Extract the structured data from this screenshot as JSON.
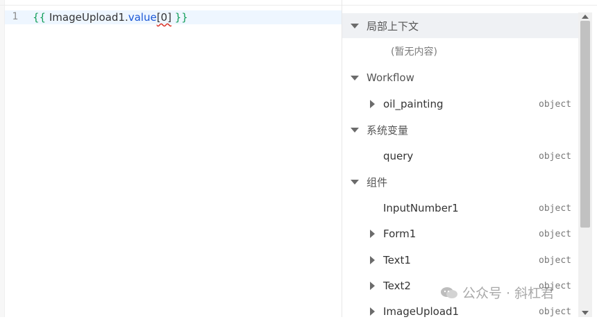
{
  "editor": {
    "line_number": "1",
    "code": {
      "open": "{{",
      "ident": " ImageUpload1.",
      "prop": "value",
      "index": "[0]",
      "close": " }}"
    }
  },
  "tree": {
    "sections": {
      "local_context": {
        "label": "局部上下文",
        "empty": "(暂无内容)"
      },
      "workflow": {
        "label": "Workflow",
        "items": [
          {
            "label": "oil_painting",
            "type": "object"
          }
        ]
      },
      "system_vars": {
        "label": "系统变量",
        "items": [
          {
            "label": "query",
            "type": "object"
          }
        ]
      },
      "components": {
        "label": "组件",
        "items": [
          {
            "label": "InputNumber1",
            "type": "object"
          },
          {
            "label": "Form1",
            "type": "object"
          },
          {
            "label": "Text1",
            "type": "object"
          },
          {
            "label": "Text2",
            "type": "object"
          },
          {
            "label": "ImageUpload1",
            "type": "object"
          }
        ]
      }
    }
  },
  "watermark": {
    "text": "公众号 · 斜杠君"
  },
  "icons": [
    "caret-down-icon",
    "caret-right-icon",
    "wechat-icon",
    "scroll-up-icon",
    "scroll-down-icon"
  ]
}
